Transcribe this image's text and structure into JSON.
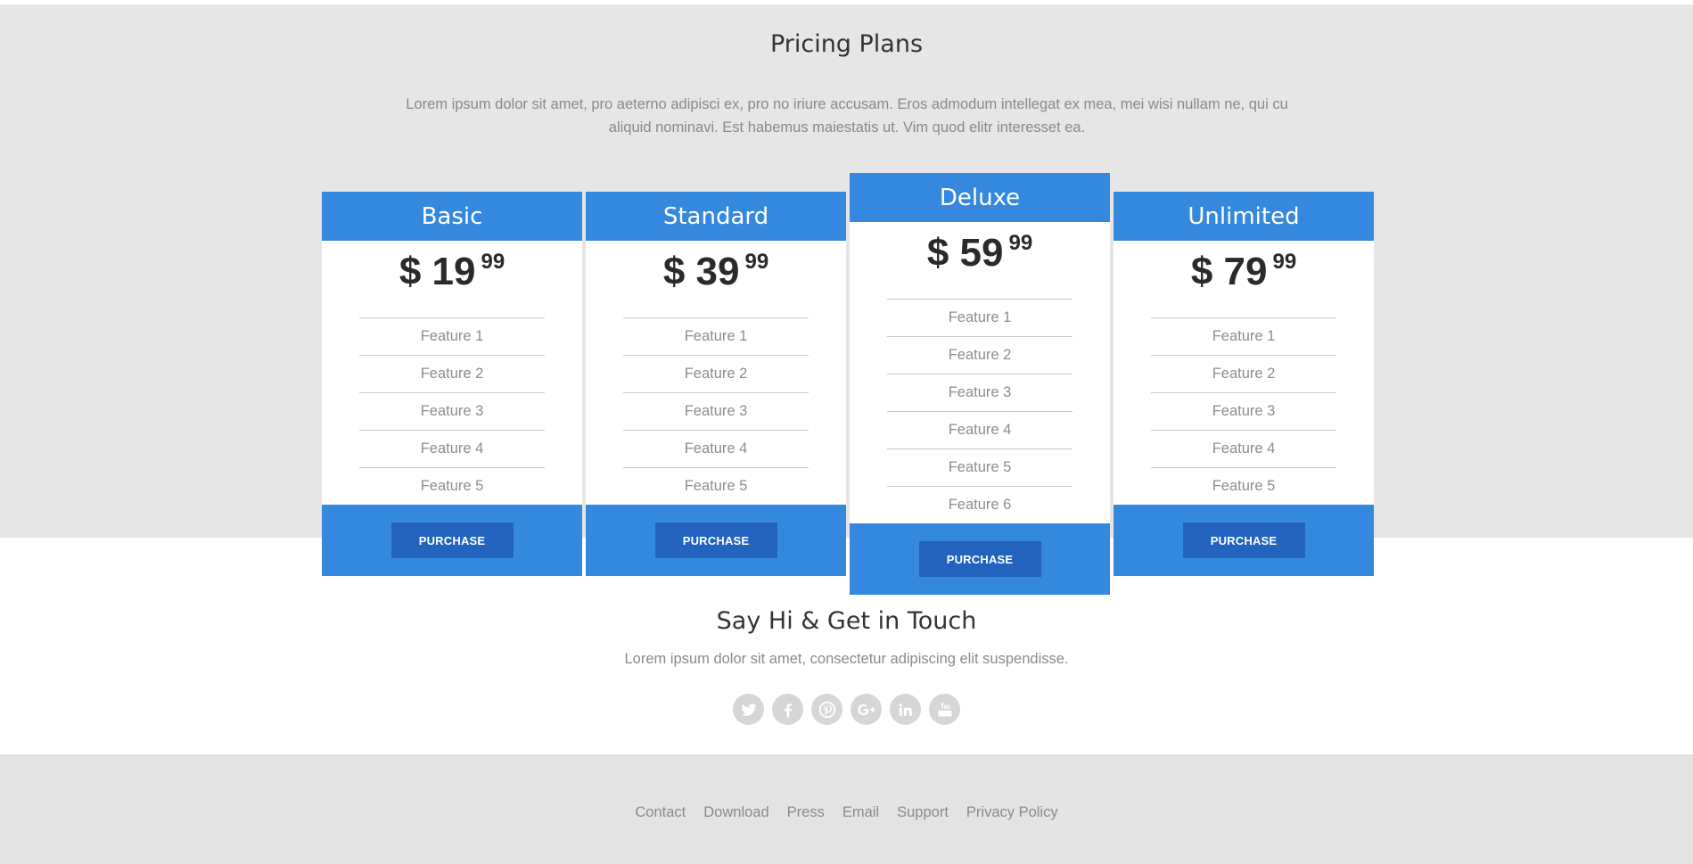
{
  "pricing": {
    "title": "Pricing Plans",
    "intro": "Lorem ipsum dolor sit amet, pro aeterno adipisci ex, pro no iriure accusam. Eros admodum intellegat ex mea, mei wisi nullam ne, qui cu aliquid nominavi. Est habemus maiestatis ut. Vim quod elitr interesset ea.",
    "plans": [
      {
        "name": "Basic",
        "currency": "$",
        "price": "19",
        "cents": "99",
        "features": [
          "Feature 1",
          "Feature 2",
          "Feature 3",
          "Feature 4",
          "Feature 5"
        ],
        "button": "PURCHASE"
      },
      {
        "name": "Standard",
        "currency": "$",
        "price": "39",
        "cents": "99",
        "features": [
          "Feature 1",
          "Feature 2",
          "Feature 3",
          "Feature 4",
          "Feature 5"
        ],
        "button": "PURCHASE"
      },
      {
        "name": "Deluxe",
        "currency": "$",
        "price": "59",
        "cents": "99",
        "features": [
          "Feature 1",
          "Feature 2",
          "Feature 3",
          "Feature 4",
          "Feature 5",
          "Feature 6"
        ],
        "button": "PURCHASE"
      },
      {
        "name": "Unlimited",
        "currency": "$",
        "price": "79",
        "cents": "99",
        "features": [
          "Feature 1",
          "Feature 2",
          "Feature 3",
          "Feature 4",
          "Feature 5"
        ],
        "button": "PURCHASE"
      }
    ]
  },
  "contact": {
    "title": "Say Hi & Get in Touch",
    "subtitle": "Lorem ipsum dolor sit amet, consectetur adipiscing elit suspendisse.",
    "social": [
      "twitter-icon",
      "facebook-icon",
      "pinterest-icon",
      "google-plus-icon",
      "linkedin-icon",
      "youtube-icon"
    ]
  },
  "footer": {
    "links": [
      "Contact",
      "Download",
      "Press",
      "Email",
      "Support",
      "Privacy Policy"
    ]
  },
  "colors": {
    "accent": "#3489de",
    "button": "#2264bd",
    "band": "#e6e6e6",
    "footer": "#e3e3e3",
    "social": "#d6d6d6"
  }
}
